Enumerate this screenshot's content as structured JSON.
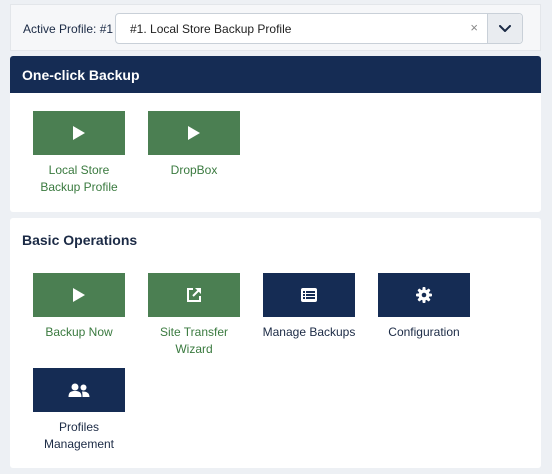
{
  "profile": {
    "label": "Active Profile: #1",
    "selected": "#1. Local Store Backup Profile",
    "clear_glyph": "×",
    "icons": {
      "clear": "close-icon",
      "dropdown": "chevron-down-icon"
    }
  },
  "oneclick": {
    "title": "One-click Backup",
    "tiles": [
      {
        "label": "Local Store Backup Profile",
        "line1": "Local Store",
        "line2": "Backup Profile",
        "icon": "play-icon",
        "color": "#4b7f52"
      },
      {
        "label": "DropBox",
        "icon": "play-icon",
        "color": "#4b7f52"
      }
    ]
  },
  "basic": {
    "title": "Basic Operations",
    "tiles": [
      {
        "label": "Backup Now",
        "icon": "play-icon",
        "color": "#4b7f52"
      },
      {
        "label": "Site Transfer Wizard",
        "line1": "Site Transfer",
        "line2": "Wizard",
        "icon": "external-link-icon",
        "color": "#4b7f52"
      },
      {
        "label": "Manage Backups",
        "icon": "list-icon",
        "color": "#152c54"
      },
      {
        "label": "Configuration",
        "icon": "gear-icon",
        "color": "#152c54"
      },
      {
        "label": "Profiles Management",
        "line1": "Profiles",
        "line2": "Management",
        "icon": "users-icon",
        "color": "#152c54"
      }
    ]
  },
  "colors": {
    "navy": "#152c54",
    "green": "#4b7f52",
    "background": "#edf0f4"
  }
}
